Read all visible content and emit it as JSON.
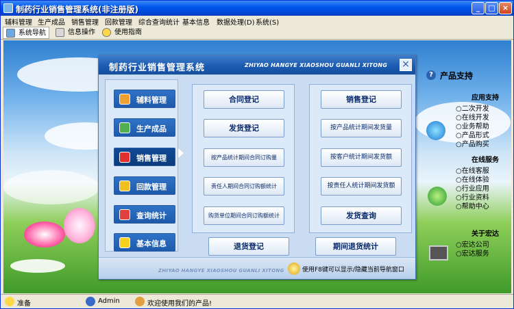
{
  "window": {
    "title": "制药行业销售管理系统(非注册版)",
    "controls": {
      "minimize": "_",
      "maximize": "□",
      "close": "×"
    }
  },
  "menu": [
    "辅料管理",
    "生产成品",
    "销售管理",
    "回款管理",
    "综合查询统计",
    "基本信息",
    "数据处理(D)",
    "系统(S)"
  ],
  "toolbar": {
    "nav": "系统导航",
    "info": "信息操作",
    "help": "使用指南"
  },
  "right_panel": {
    "support_title": "产品支持",
    "app_support": "应用支持",
    "app_items": [
      "二次开发",
      "在线开发",
      "业务帮助",
      "产品形式",
      "产品购买"
    ],
    "online_service": "在线服务",
    "service_items": [
      "在线客服",
      "在线体验",
      "行业应用",
      "行业资料",
      "帮助中心"
    ],
    "about": "关于宏达",
    "about_items": [
      "宏达公司",
      "宏达服务"
    ]
  },
  "dialog": {
    "title": "制药行业销售管理系统",
    "subtitle": "ZHIYAO HANGYE XIAOSHOU GUANLI XITONG",
    "close": "×",
    "nav": [
      {
        "label": "辅料管理",
        "icon": "toolbox-icon",
        "color": "#f0a030"
      },
      {
        "label": "生产成品",
        "icon": "users-icon",
        "color": "#50b050"
      },
      {
        "label": "销售管理",
        "icon": "sales-icon",
        "color": "#e03030",
        "active": true
      },
      {
        "label": "回款管理",
        "icon": "coins-icon",
        "color": "#f0c020"
      },
      {
        "label": "查询统计",
        "icon": "book-icon",
        "color": "#e04040"
      },
      {
        "label": "基本信息",
        "icon": "star-icon",
        "color": "#f8d020"
      }
    ],
    "left_actions": [
      "合同登记",
      "发货登记",
      "按产品统计期间合同订购量",
      "责任人期间合同订购额统计",
      "购货单位期间合同订购额统计"
    ],
    "right_actions": [
      "销售登记",
      "按产品统计期间发货量",
      "按客户统计期间发货额",
      "按责任人统计期间发货额",
      "发货查询"
    ],
    "bottom_left": "退货登记",
    "bottom_right": "期间退货统计",
    "footer_subtitle": "ZHIYAO HANGYE XIAOSHOU GUANLI XITONG",
    "footer_tip": "使用F8键可以显示/隐藏当前导航窗口"
  },
  "status": {
    "ready": "准备",
    "user": "Admin",
    "welcome": "欢迎使用我们的产品!"
  }
}
